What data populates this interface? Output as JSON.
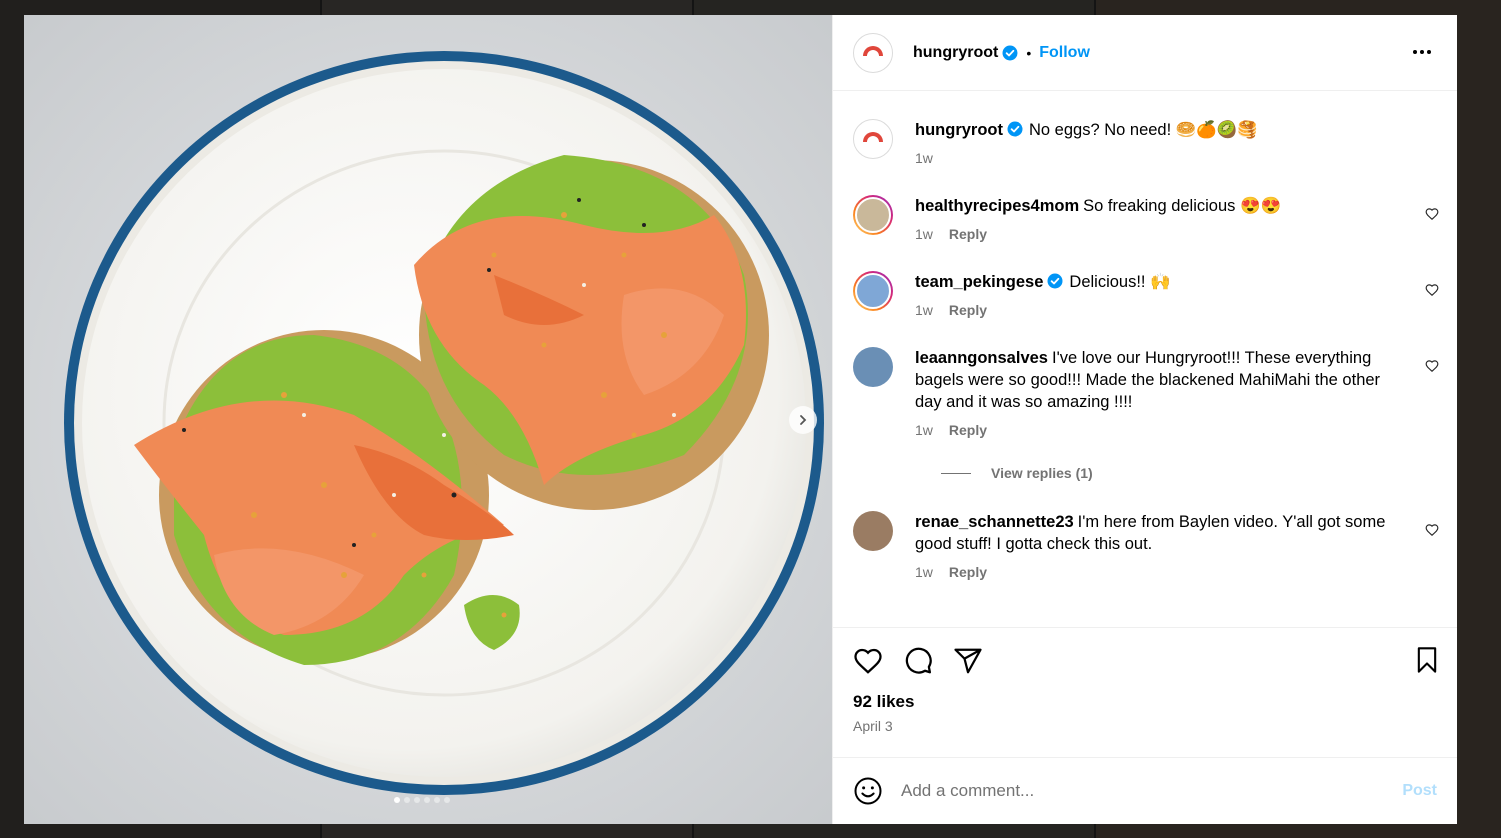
{
  "post": {
    "author": "hungryroot",
    "follow_label": "Follow",
    "separator": "•",
    "caption_text": "No eggs? No need! 🥯🍊🥝🥞",
    "caption_time": "1w",
    "likes": "92 likes",
    "date": "April 3",
    "media_dots": 6,
    "media_active_index": 0
  },
  "comments": [
    {
      "user": "healthyrecipes4mom",
      "verified": false,
      "text": "So freaking delicious 😍😍",
      "time": "1w",
      "reply": "Reply",
      "avatar_color": "#c9b89a"
    },
    {
      "user": "team_pekingese",
      "verified": true,
      "text": "Delicious!! 🙌",
      "time": "1w",
      "reply": "Reply",
      "avatar_color": "#7fa7d6"
    },
    {
      "user": "leaanngonsalves",
      "verified": false,
      "text": "I've love our Hungryroot!!! These everything bagels were so good!!! Made the blackened MahiMahi the other day and it was so amazing !!!!",
      "time": "1w",
      "reply": "Reply",
      "avatar_color": "#6a8fb5",
      "view_replies": "View replies (1)"
    },
    {
      "user": "renae_schannette23",
      "verified": false,
      "text": "I'm here from Baylen video. Y'all got some good stuff! I gotta check this out.",
      "time": "1w",
      "reply": "Reply",
      "avatar_color": "#9a7c63"
    }
  ],
  "composer": {
    "placeholder": "Add a comment...",
    "post_label": "Post"
  },
  "colors": {
    "accent": "#0095f6",
    "verified": "#0095f6",
    "muted": "#737373"
  },
  "icons": {
    "like": "heart-icon",
    "comment": "comment-icon",
    "share": "share-icon",
    "save": "bookmark-icon",
    "emoji": "emoji-icon",
    "more": "more-options-icon",
    "next": "chevron-right-icon"
  }
}
